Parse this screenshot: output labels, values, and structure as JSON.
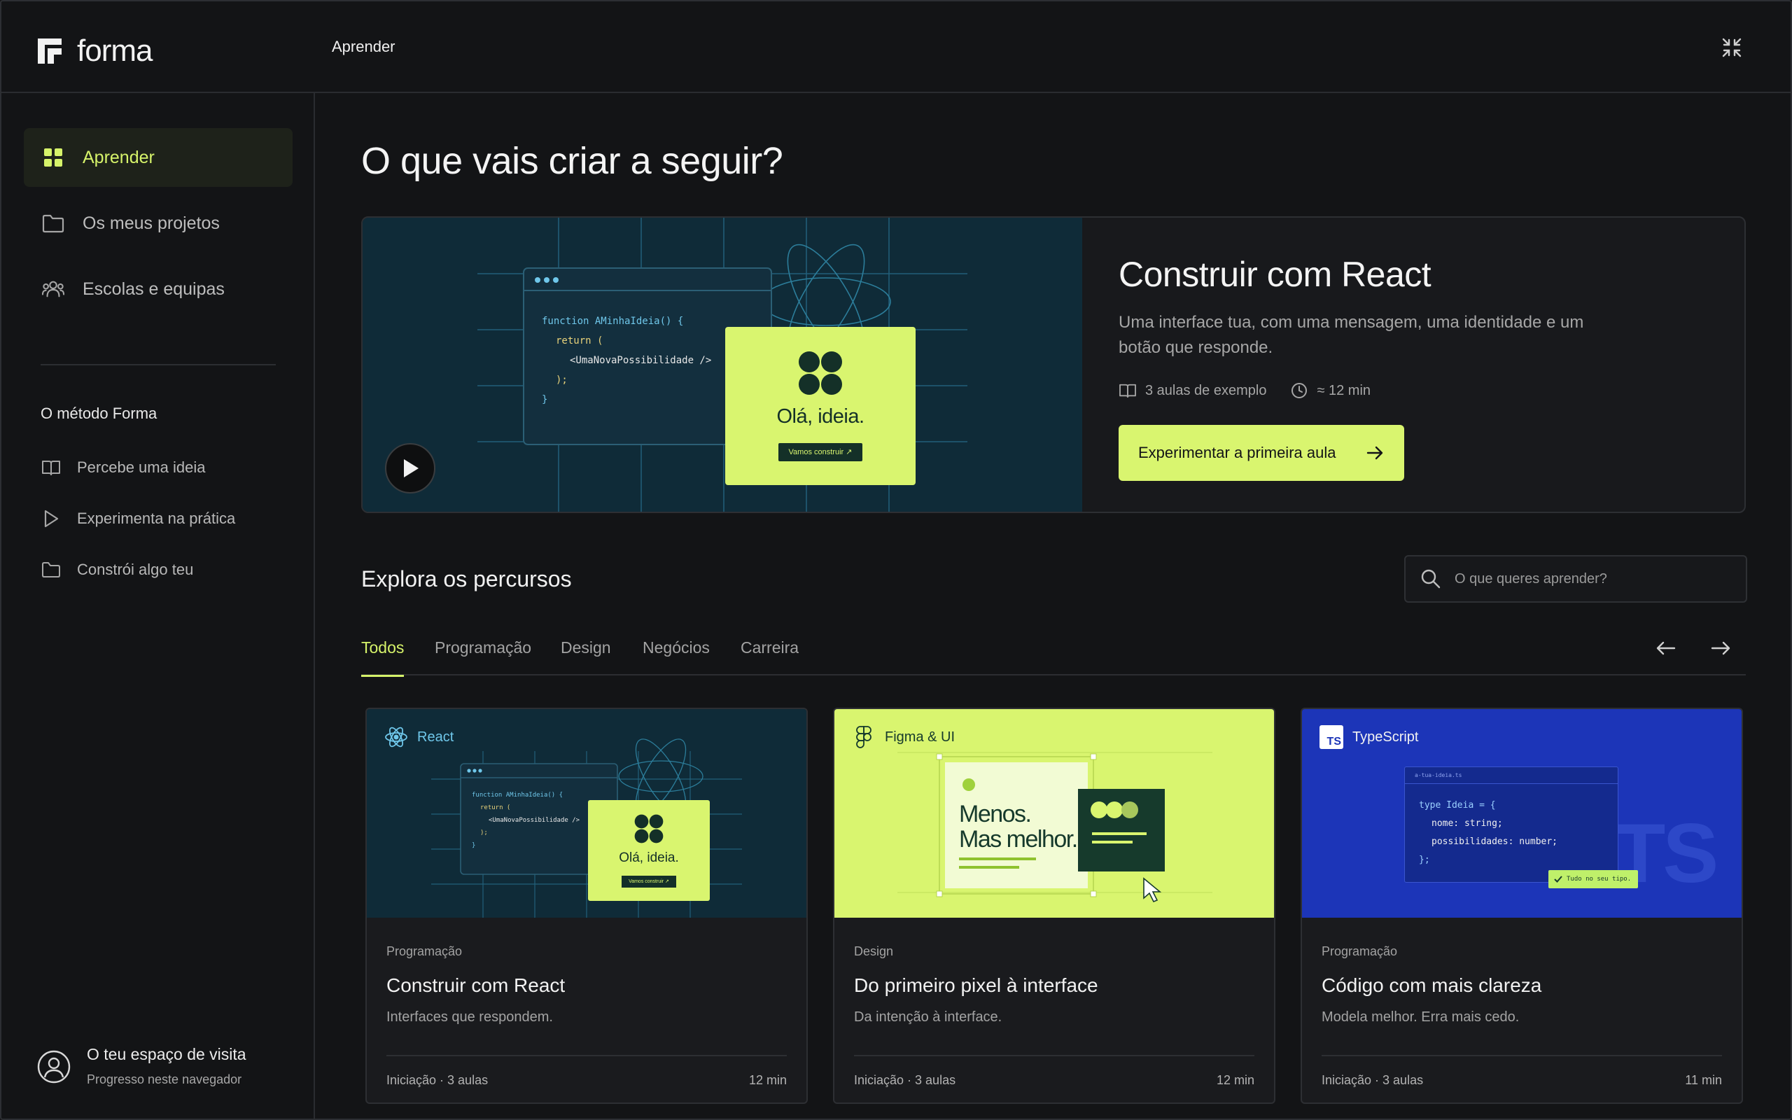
{
  "app": {
    "brand": "forma",
    "section_title": "Aprender"
  },
  "sidebar": {
    "nav": [
      {
        "label": "Aprender",
        "icon": "grid-icon",
        "active": true
      },
      {
        "label": "Os meus projetos",
        "icon": "folder-icon",
        "active": false
      },
      {
        "label": "Escolas e equipas",
        "icon": "users-icon",
        "active": false
      }
    ],
    "method_heading": "O método Forma",
    "method_items": [
      {
        "label": "Percebe uma ideia",
        "icon": "book-open-icon"
      },
      {
        "label": "Experimenta na prática",
        "icon": "play-outline-icon"
      },
      {
        "label": "Constrói algo teu",
        "icon": "folder-icon"
      }
    ],
    "guest": {
      "name": "O teu espaço de visita",
      "sub": "Progresso neste navegador"
    }
  },
  "main": {
    "title": "O que vais criar a seguir?",
    "hero": {
      "title": "Construir com React",
      "description": "Uma interface tua, com uma mensagem, uma identidade e um botão que responde.",
      "lessons": "3 aulas de exemplo",
      "duration": "≈ 12 min",
      "cta": "Experimentar a primeira aula",
      "code": [
        "function AMinhaIdeia() {",
        "return (",
        "<UmaNovaPossibilidade />",
        ");",
        "}"
      ],
      "preview_text": "Olá, ideia.",
      "preview_button": "Vamos construir ↗"
    },
    "explore_title": "Explora os percursos",
    "search_placeholder": "O que queres aprender?",
    "tabs": [
      "Todos",
      "Programação",
      "Design",
      "Negócios",
      "Carreira"
    ],
    "cards": [
      {
        "tag": "React",
        "category": "Programação",
        "title": "Construir com React",
        "description": "Interfaces que respondem.",
        "level": "Iniciação · 3 aulas",
        "duration": "12 min",
        "preview_text": "Olá, ideia.",
        "preview_button": "Vamos construir ↗",
        "code": [
          "function AMinhaIdeia() {",
          "return (",
          "<UmaNovaPossibilidade />",
          ");",
          "}"
        ]
      },
      {
        "tag": "Figma & UI",
        "category": "Design",
        "title": "Do primeiro pixel à interface",
        "description": "Da intenção à interface.",
        "level": "Iniciação · 3 aulas",
        "duration": "12 min",
        "headline_1": "Menos.",
        "headline_2": "Mas melhor."
      },
      {
        "tag": "TypeScript",
        "category": "Programação",
        "title": "Código com mais clareza",
        "description": "Modela melhor. Erra mais cedo.",
        "level": "Iniciação · 3 aulas",
        "duration": "11 min",
        "file_name": "a-tua-ideia.ts",
        "code": [
          "type Ideia = {",
          "nome: string;",
          "possibilidades: number;",
          "};"
        ],
        "badge": "Tudo no seu tipo.",
        "logo_text": "TS",
        "watermark": "TS"
      }
    ]
  },
  "colors": {
    "accent": "#d6f36a",
    "cta": "#d9f56f",
    "react_bg": "#0f2b38",
    "figma_bg": "#d9f56f",
    "ts_bg": "#1c35b8"
  }
}
